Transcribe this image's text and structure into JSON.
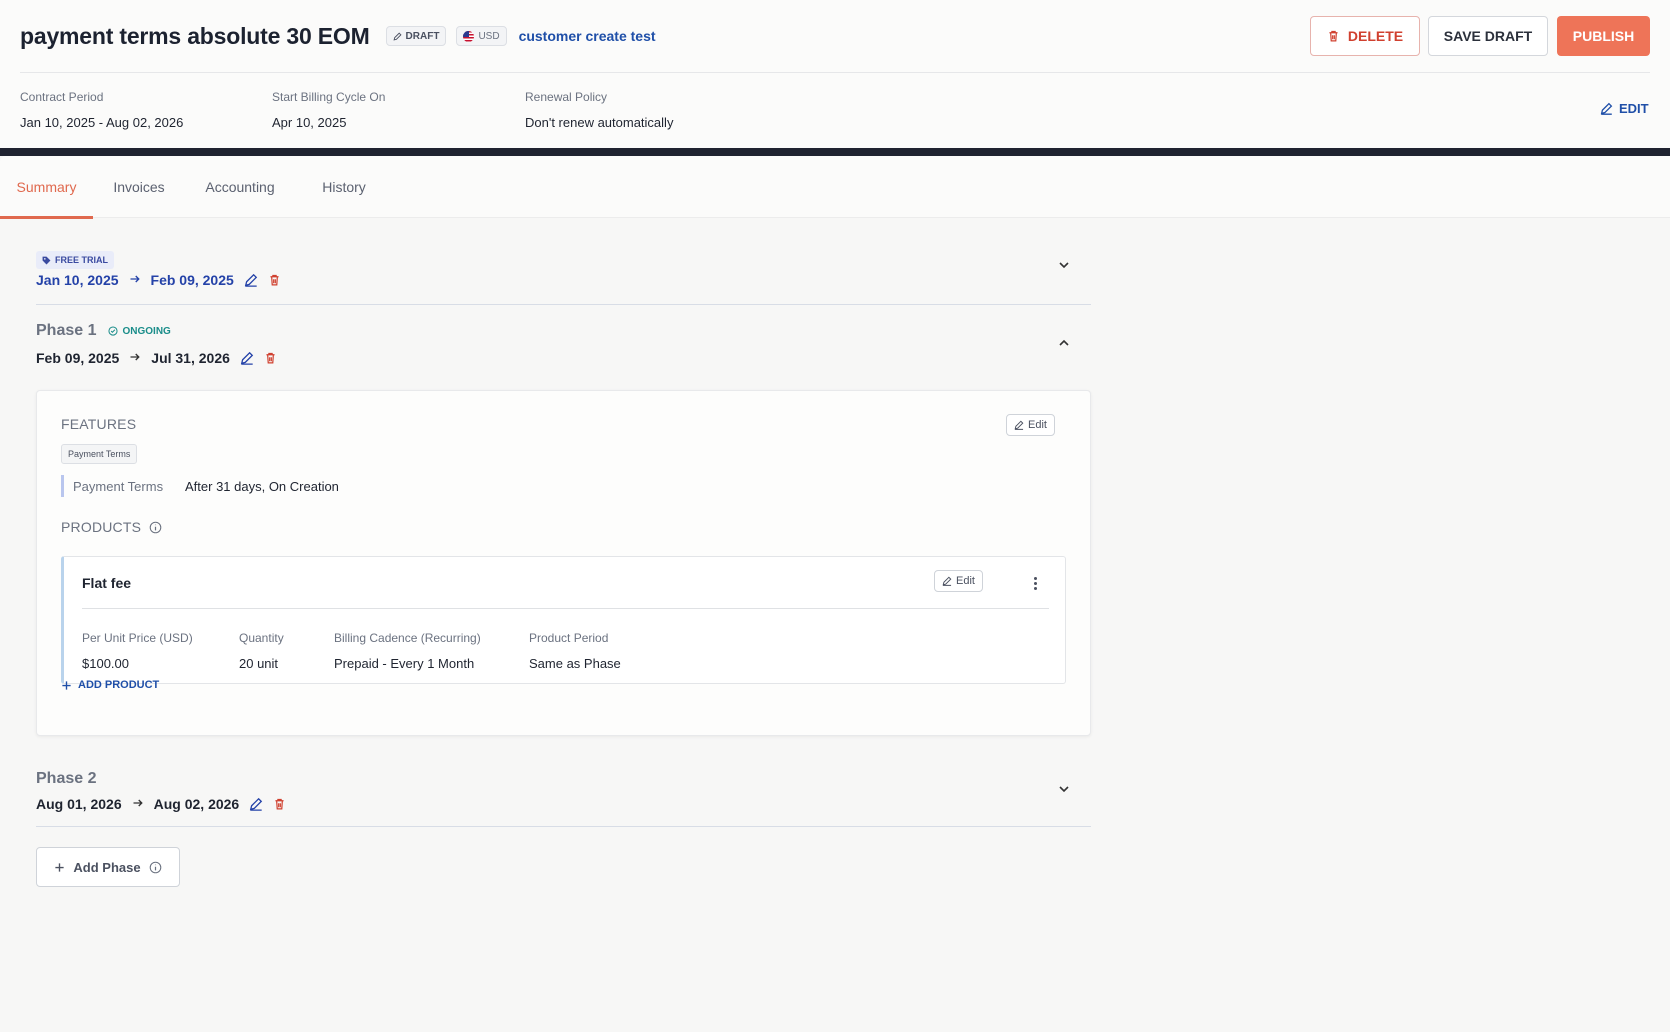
{
  "header": {
    "title": "payment terms absolute 30 EOM",
    "status_chip": "DRAFT",
    "currency_chip": "USD",
    "customer_link": "customer create test",
    "buttons": {
      "delete": "DELETE",
      "save_draft": "SAVE DRAFT",
      "publish": "PUBLISH"
    },
    "meta": [
      {
        "label": "Contract Period",
        "value": "Jan 10, 2025 - Aug 02, 2026"
      },
      {
        "label": "Start Billing Cycle On",
        "value": "Apr 10, 2025"
      },
      {
        "label": "Renewal Policy",
        "value": "Don't renew automatically"
      }
    ],
    "edit_label": "EDIT"
  },
  "tabs": [
    {
      "label": "Summary",
      "active": true
    },
    {
      "label": "Invoices",
      "active": false
    },
    {
      "label": "Accounting",
      "active": false
    },
    {
      "label": "History",
      "active": false
    }
  ],
  "free_trial": {
    "badge": "FREE TRIAL",
    "start": "Jan 10, 2025",
    "end": "Feb 09, 2025"
  },
  "phase1": {
    "title": "Phase 1",
    "status": "ONGOING",
    "start": "Feb 09, 2025",
    "end": "Jul 31, 2026",
    "features": {
      "heading": "FEATURES",
      "edit_label": "Edit",
      "tag": "Payment Terms",
      "items": [
        {
          "label": "Payment Terms",
          "value": "After 31 days, On Creation"
        }
      ]
    },
    "products": {
      "heading": "PRODUCTS",
      "items": [
        {
          "name": "Flat fee",
          "edit_label": "Edit",
          "fields": [
            {
              "label": "Per Unit Price (USD)",
              "value": "$100.00"
            },
            {
              "label": "Quantity",
              "value": "20 unit"
            },
            {
              "label": "Billing Cadence (Recurring)",
              "value": "Prepaid - Every 1 Month"
            },
            {
              "label": "Product Period",
              "value": "Same as Phase"
            }
          ]
        }
      ],
      "add_label": "ADD PRODUCT"
    }
  },
  "phase2": {
    "title": "Phase 2",
    "start": "Aug 01, 2026",
    "end": "Aug 02, 2026"
  },
  "add_phase_label": "Add Phase",
  "colors": {
    "accent": "#ee7458",
    "link": "#1f4fa8",
    "danger": "#d0402f",
    "ongoing": "#1a8d8a",
    "dark_bar": "#1f2330"
  },
  "icons": {
    "chip_draft": "pencil-icon",
    "chip_currency": "us-flag-icon",
    "delete": "trash-icon",
    "edit": "pencil-icon",
    "arrow": "arrow-right-icon",
    "collapse": "chevron-down-icon",
    "expand": "chevron-up-icon",
    "info": "info-icon",
    "add": "plus-icon",
    "kebab": "more-vertical-icon",
    "tag": "tag-icon",
    "status": "check-circle-icon"
  }
}
